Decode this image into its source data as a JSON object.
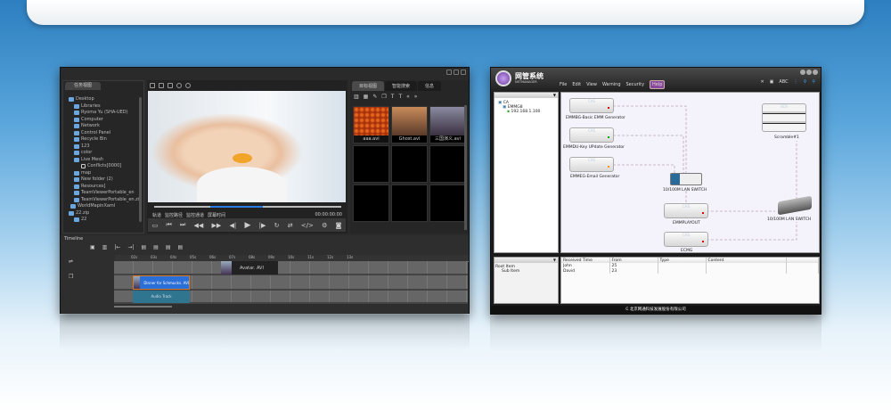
{
  "video_editor": {
    "left_tab": "任务视图",
    "tree": [
      "Desktop",
      "Libraries",
      "Ryoma Yu (SHA-UED)",
      "Computer",
      "Network",
      "Control Panel",
      "Recycle Bin",
      "123",
      "color",
      "Live Mesh",
      "Conflicts[0000]",
      "map",
      "New folder (2)",
      "Resources]",
      "TeamViewerPortable_en",
      "TeamViewerPortable_en.zip",
      "WorldMapinXaml",
      "22.zip",
      "22"
    ],
    "preview_labels": [
      "轨道",
      "监控路径",
      "监控通道",
      "屏幕时间"
    ],
    "timecode": "00:00:00:00",
    "right_tabs": [
      "目标视图",
      "智能搜索",
      "信息"
    ],
    "thumbnails": [
      "aaa.avi",
      "Ghost.avi",
      "三国演义.avi"
    ],
    "timeline_title": "Timeline",
    "ruler": [
      "02s",
      "03s",
      "04s",
      "05s",
      "06s",
      "07s",
      "08s",
      "09s",
      "10s",
      "11s",
      "12s",
      "13s"
    ],
    "clips": {
      "video1": "Avatar. AVI",
      "video2": "Dinner for Schmucks. AVI",
      "audio": "Audio Track"
    }
  },
  "net_manager": {
    "logo_title": "网管系统",
    "logo_sub": "NETMANAGER",
    "menu": [
      "File",
      "Edit",
      "View",
      "Warning",
      "Security",
      "Help"
    ],
    "active_menu": "Help",
    "toolbar_text": "ABC",
    "tree": [
      "CA",
      "EMMG8",
      "192.168.1.100"
    ],
    "devices": {
      "cas_label": "CAS",
      "scr_label": "SCR",
      "emmg_basic": "EMMBG-Basic EMM Generator",
      "emmg_key": "EMMDU-Key UPdate Generator",
      "emmg_email": "EMMEG-Email Generator",
      "switch1": "10/100M LAN SWITCH",
      "emm_layout": "EMMPLAYOUT",
      "ecmg": "ECMG",
      "scrambler": "Scramble#1",
      "switch2": "10/100M LAN SWITCH"
    },
    "bottom_tree": [
      "Root Item",
      "Sub Item"
    ],
    "table": {
      "headers": [
        "Received Time",
        "From",
        "Type",
        "Content"
      ],
      "rows": [
        [
          "John",
          "25",
          "",
          ""
        ],
        [
          "David",
          "23",
          "",
          ""
        ]
      ]
    },
    "footer": "北京网通科技发展股份有限公司"
  }
}
